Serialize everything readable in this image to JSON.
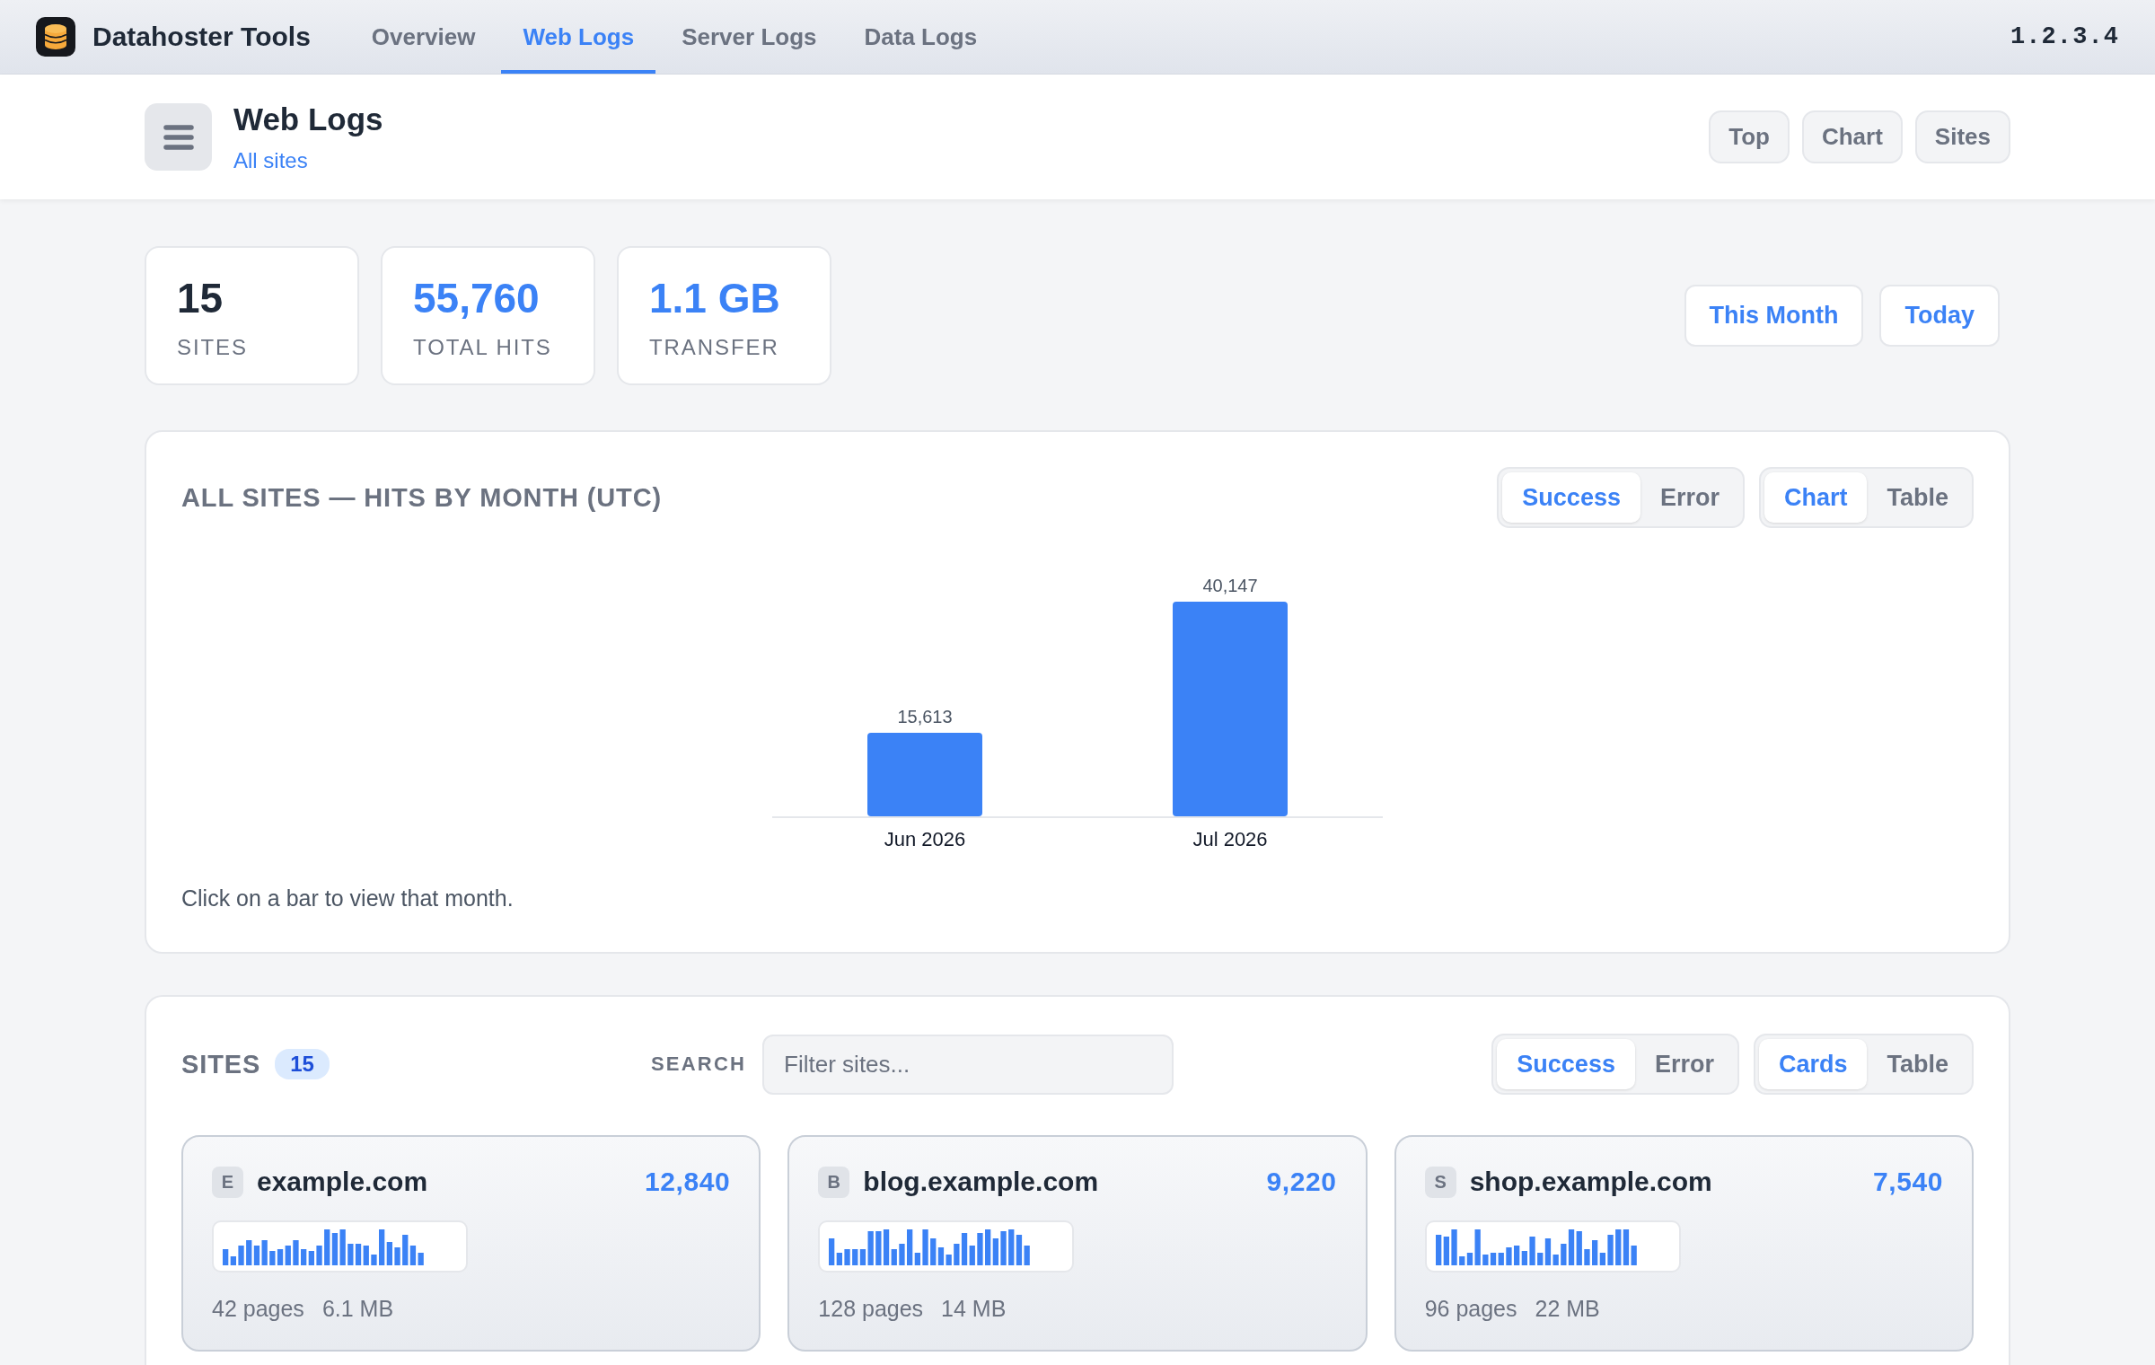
{
  "app": {
    "name": "Datahoster Tools",
    "version": "1.2.3.4"
  },
  "nav_tabs": [
    {
      "label": "Overview",
      "selected": false
    },
    {
      "label": "Web Logs",
      "selected": true
    },
    {
      "label": "Server Logs",
      "selected": false
    },
    {
      "label": "Data Logs",
      "selected": false
    }
  ],
  "header": {
    "title": "Web Logs",
    "subtitle_link": "All sites",
    "buttons": [
      "Top",
      "Chart",
      "Sites"
    ]
  },
  "stats": [
    {
      "value": "15",
      "label": "SITES",
      "color": "#1f2937"
    },
    {
      "value": "55,760",
      "label": "TOTAL HITS",
      "color": "#3b82f6"
    },
    {
      "value": "1.1 GB",
      "label": "TRANSFER",
      "color": "#3b82f6"
    }
  ],
  "period_buttons": [
    "This Month",
    "Today"
  ],
  "chart_panel": {
    "title": "ALL SITES — HITS BY MONTH (UTC)",
    "metric_toggle": [
      {
        "label": "Success",
        "selected": true
      },
      {
        "label": "Error",
        "selected": false
      }
    ],
    "view_toggle": [
      {
        "label": "Chart",
        "selected": true
      },
      {
        "label": "Table",
        "selected": false
      }
    ],
    "chart_data": {
      "type": "bar",
      "categories": [
        "Jun 2026",
        "Jul 2026"
      ],
      "values": [
        15613,
        40147
      ],
      "value_labels": [
        "15,613",
        "40,147"
      ]
    },
    "hint": "Click on a bar to view that month."
  },
  "sites_panel": {
    "title": "SITES",
    "count": "15",
    "search": {
      "label": "SEARCH",
      "placeholder": "Filter sites..."
    },
    "metric_toggle": [
      {
        "label": "Success",
        "selected": true
      },
      {
        "label": "Error",
        "selected": false
      }
    ],
    "view_toggle": [
      {
        "label": "Cards",
        "selected": true
      },
      {
        "label": "Table",
        "selected": false
      }
    ],
    "sites": [
      {
        "initial": "E",
        "name": "example.com",
        "hits": "12,840",
        "pages": "42 pages",
        "size": "6.1 MB"
      },
      {
        "initial": "B",
        "name": "blog.example.com",
        "hits": "9,220",
        "pages": "128 pages",
        "size": "14 MB"
      },
      {
        "initial": "S",
        "name": "shop.example.com",
        "hits": "7,540",
        "pages": "96 pages",
        "size": "22 MB"
      }
    ]
  }
}
